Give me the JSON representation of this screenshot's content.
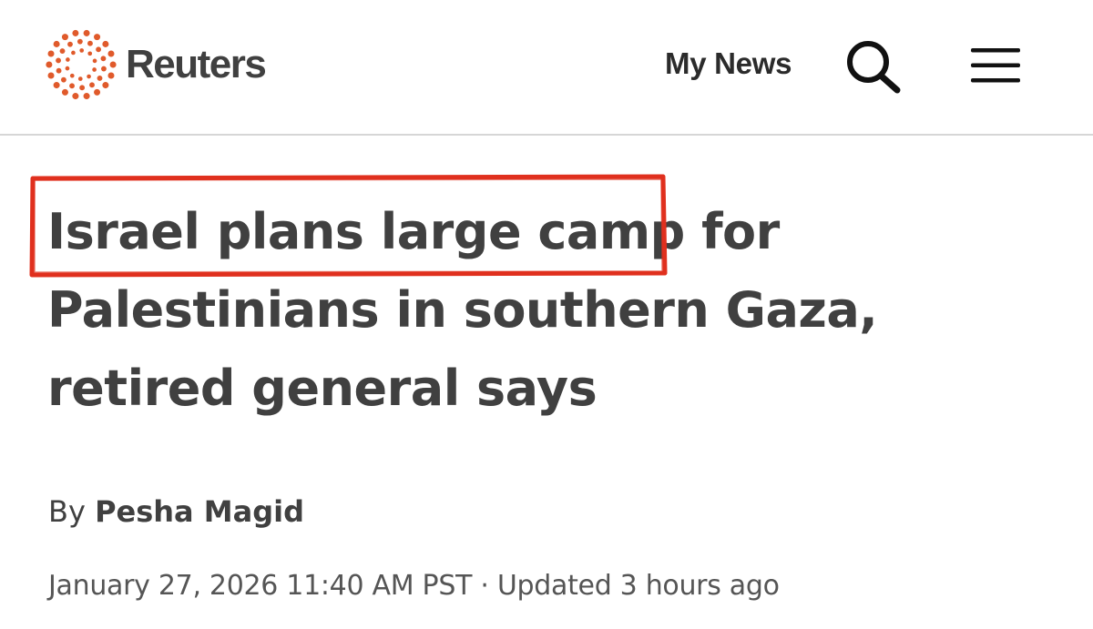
{
  "header": {
    "brand": "Reuters",
    "brand_color": "#e05a2b",
    "my_news_label": "My News",
    "search_icon": "search-icon",
    "menu_icon": "hamburger-menu-icon"
  },
  "article": {
    "headline_highlighted": "Israel plans large camp",
    "headline_rest": " for Palestinians in southern Gaza, retired general says",
    "highlight_color": "#e0301e",
    "byline_prefix": "By",
    "author": "Pesha Magid",
    "published": "January 27, 2026 11:40 AM PST",
    "separator": "·",
    "updated": "Updated 3 hours ago"
  }
}
